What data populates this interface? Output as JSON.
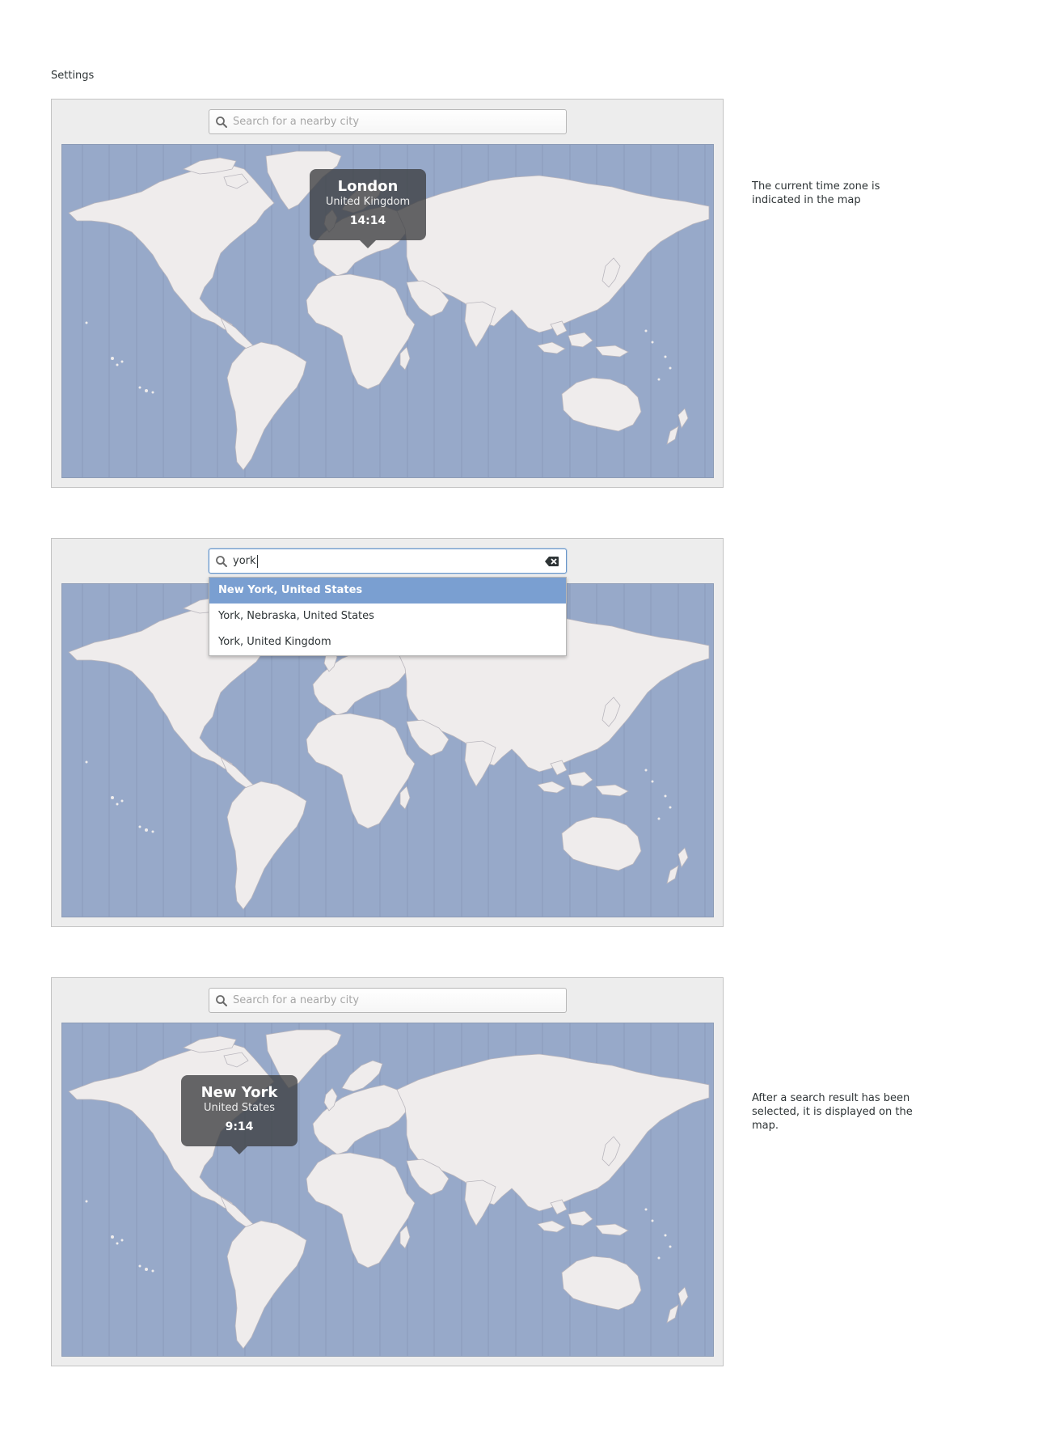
{
  "page": {
    "title": "Settings"
  },
  "colors": {
    "map_ocean": "#97a9c9",
    "map_land": "#efecec",
    "selection": "#7a9fd1",
    "bubble": "#3c3e40"
  },
  "panel1": {
    "search": {
      "placeholder": "Search for a nearby city",
      "icon": "search-icon"
    },
    "bubble": {
      "city": "London",
      "country": "United Kingdom",
      "time": "14:14"
    },
    "note": "The current time zone is indicated in the map"
  },
  "panel2": {
    "search": {
      "value": "york",
      "icon": "search-icon",
      "clear_icon": "clear-text-icon"
    },
    "results": [
      {
        "label": "New York, United States",
        "selected": true
      },
      {
        "label": "York, Nebraska, United States",
        "selected": false
      },
      {
        "label": "York, United Kingdom",
        "selected": false
      }
    ]
  },
  "panel3": {
    "search": {
      "placeholder": "Search for a nearby city",
      "icon": "search-icon"
    },
    "bubble": {
      "city": "New York",
      "country": "United States",
      "time": "9:14"
    },
    "note": "After a search result has been selected, it is displayed on the map."
  }
}
